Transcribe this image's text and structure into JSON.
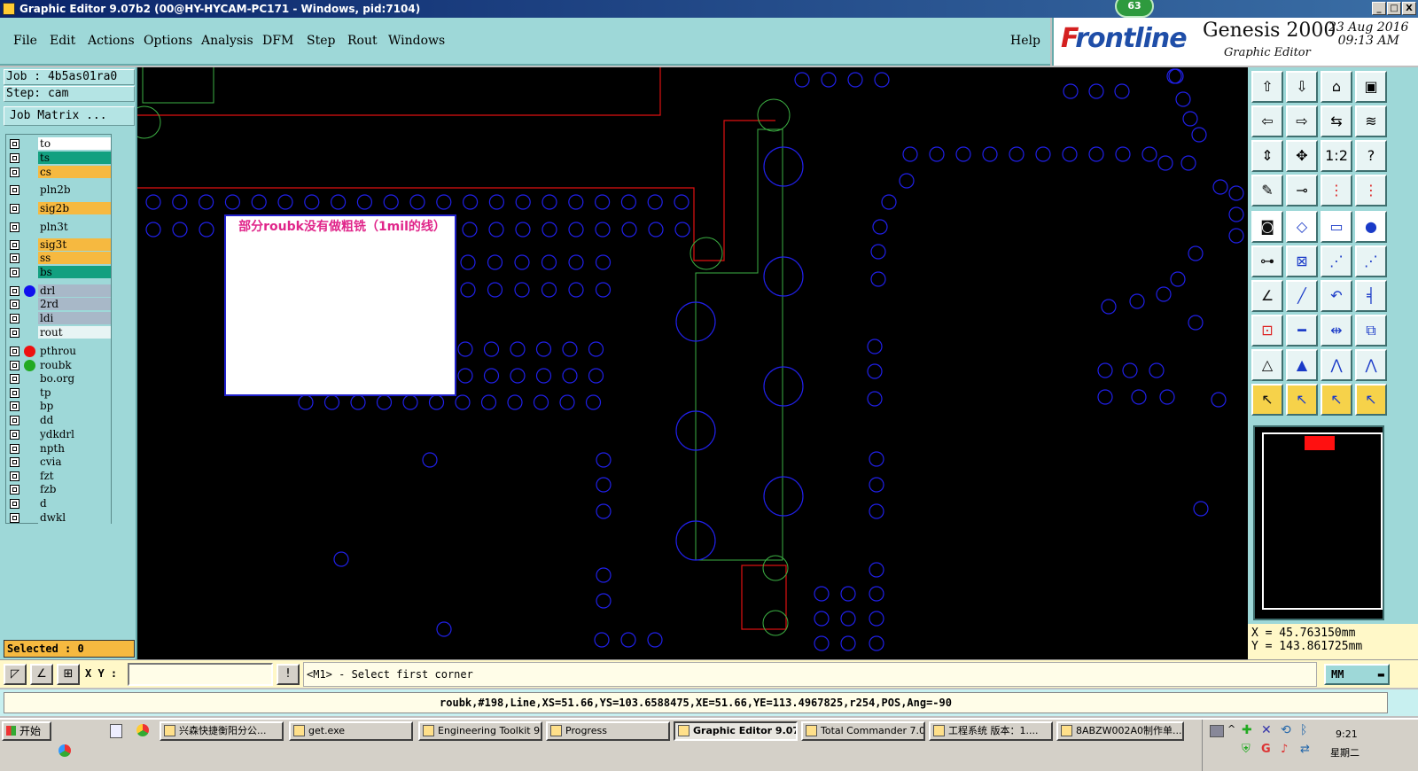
{
  "window": {
    "title": "Graphic Editor 9.07b2 (00@HY-HYCAM-PC171 - Windows, pid:7104)",
    "badge": "63",
    "min": "_",
    "max": "□",
    "close": "X"
  },
  "menu": {
    "items": [
      "File",
      "Edit",
      "Actions",
      "Options",
      "Analysis",
      "DFM",
      "Step",
      "Rout",
      "Windows"
    ],
    "help": "Help"
  },
  "logo": {
    "brand_f": "F",
    "brand_rest": "rontline",
    "product": "Genesis 2000",
    "subtitle": "Graphic Editor",
    "date": "23 Aug 2016",
    "time": "09:13 AM"
  },
  "left": {
    "job": "Job : 4b5as01ra0",
    "step": "Step: cam",
    "job_matrix": "Job Matrix ...",
    "selected": "Selected : 0",
    "layers": [
      {
        "name": "to",
        "color": "#ffffff",
        "dot": ""
      },
      {
        "name": "ts",
        "color": "#12a080",
        "dot": ""
      },
      {
        "name": "cs",
        "color": "#f6b940",
        "dot": ""
      },
      {
        "name": "pln2b",
        "color": "#9ed8d8",
        "dot": ""
      },
      {
        "name": "sig2b",
        "color": "#f6b940",
        "dot": ""
      },
      {
        "name": "pln3t",
        "color": "#9ed8d8",
        "dot": ""
      },
      {
        "name": "sig3t",
        "color": "#f6b940",
        "dot": ""
      },
      {
        "name": "ss",
        "color": "#f6b940",
        "dot": ""
      },
      {
        "name": "bs",
        "color": "#12a080",
        "dot": ""
      },
      {
        "name": "drl",
        "color": "#a8b8c8",
        "dot": "#1010ee"
      },
      {
        "name": "2rd",
        "color": "#a8b8c8",
        "dot": ""
      },
      {
        "name": "ldi",
        "color": "#a8b8c8",
        "dot": ""
      },
      {
        "name": "rout",
        "color": "#e8f4f4",
        "dot": ""
      },
      {
        "name": "pthrou",
        "color": "#9ed8d8",
        "dot": "#ee1010"
      },
      {
        "name": "roubk",
        "color": "#9ed8d8",
        "dot": "#22aa22"
      },
      {
        "name": "bo.org",
        "color": "#9ed8d8",
        "dot": ""
      },
      {
        "name": "tp",
        "color": "#9ed8d8",
        "dot": ""
      },
      {
        "name": "bp",
        "color": "#9ed8d8",
        "dot": ""
      },
      {
        "name": "dd",
        "color": "#9ed8d8",
        "dot": ""
      },
      {
        "name": "ydkdrl",
        "color": "#9ed8d8",
        "dot": ""
      },
      {
        "name": "npth",
        "color": "#9ed8d8",
        "dot": ""
      },
      {
        "name": "cvia",
        "color": "#9ed8d8",
        "dot": ""
      },
      {
        "name": "fzt",
        "color": "#9ed8d8",
        "dot": ""
      },
      {
        "name": "fzb",
        "color": "#9ed8d8",
        "dot": ""
      },
      {
        "name": "d",
        "color": "#9ed8d8",
        "dot": ""
      },
      {
        "name": "dwkl",
        "color": "#9ed8d8",
        "dot": ""
      }
    ]
  },
  "canvas": {
    "note_text": "部分roubk没有做粗铣（1mil的线）"
  },
  "right": {
    "coord_x": "X = 45.763150mm",
    "coord_y": "Y = 143.861725mm"
  },
  "command": {
    "xy_label": "X Y :",
    "xy_value": "",
    "prompt": "<M1> - Select first corner",
    "units": "MM",
    "status": "roubk,#198,Line,XS=51.66,YS=103.6588475,XE=51.66,YE=113.4967825,r254,POS,Ang=-90"
  },
  "taskbar": {
    "start": "开始",
    "tasks": [
      "兴森快捷衡阳分公...",
      "get.exe",
      "Engineering Toolkit 9....",
      "Progress",
      "Graphic Editor 9.07...",
      "Total Commander 7.0 ...",
      "工程系统  版本：1....",
      "8ABZW002A0制作单...."
    ],
    "time": "9:21",
    "day": "星期二"
  }
}
